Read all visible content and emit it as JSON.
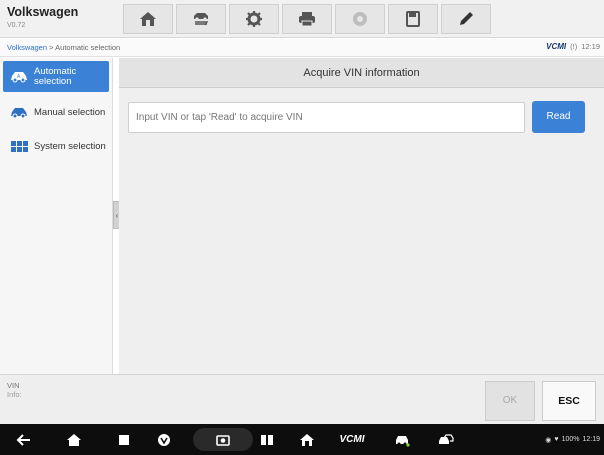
{
  "header": {
    "title": "Volkswagen",
    "version": "V0.72",
    "tools": [
      {
        "icon": "home-icon"
      },
      {
        "icon": "vehicle-swap-icon"
      },
      {
        "icon": "settings-icon"
      },
      {
        "icon": "print-icon"
      },
      {
        "icon": "help-icon"
      },
      {
        "icon": "save-icon"
      },
      {
        "icon": "edit-icon"
      }
    ]
  },
  "breadcrumb": {
    "root": "Volkswagen",
    "separator": " > ",
    "current": "Automatic selection"
  },
  "status": {
    "vci": "VCMI",
    "indicator": "(!)",
    "time": "12:19"
  },
  "sidebar": {
    "items": [
      {
        "label": "Automatic selection",
        "icon": "auto-car-icon",
        "active": true
      },
      {
        "label": "Manual selection",
        "icon": "manual-car-icon",
        "active": false
      },
      {
        "label": "System selection",
        "icon": "system-grid-icon",
        "active": false
      }
    ]
  },
  "main": {
    "title": "Acquire VIN information",
    "vin_placeholder": "Input VIN or tap 'Read' to acquire VIN",
    "vin_value": "",
    "read_label": "Read"
  },
  "infobar": {
    "vin_label": "VIN",
    "info_label": "Info:",
    "ok_label": "OK",
    "esc_label": "ESC"
  },
  "navbar": {
    "vci_label": "VCMI",
    "battery": "100%",
    "time": "12:19"
  },
  "colors": {
    "accent": "#3b82d6",
    "header_bg": "#f1f1f1",
    "nav_bg": "#0d0d0d"
  }
}
